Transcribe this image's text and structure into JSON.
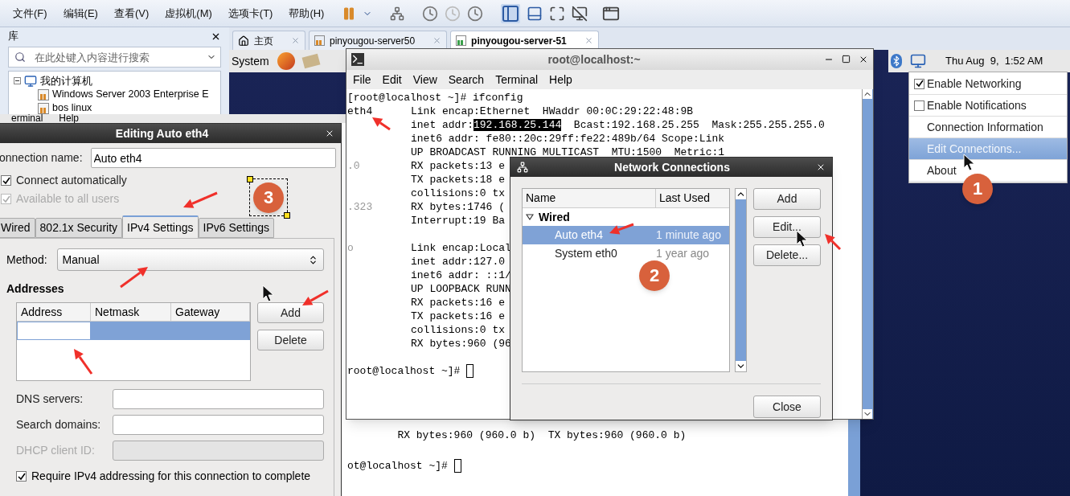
{
  "menu_bar": [
    "文件(F)",
    "编辑(E)",
    "查看(V)",
    "虚拟机(M)",
    "选项卡(T)",
    "帮助(H)"
  ],
  "library": {
    "title": "库",
    "search": {
      "placeholder": "在此处键入内容进行搜索"
    },
    "tree": [
      {
        "label": "我的计算机",
        "expanded": true,
        "children": [
          {
            "label": "Windows Server 2003 Enterprise E"
          },
          {
            "label": "bos linux"
          }
        ]
      }
    ]
  },
  "tabs": [
    {
      "label": "主页",
      "kind": "home",
      "selected": false
    },
    {
      "label": "pinyougou-server50",
      "kind": "vm",
      "selected": false
    },
    {
      "label": "pinyougou-server-51",
      "kind": "vm",
      "selected": true
    }
  ],
  "guest_panel": {
    "menu": "System",
    "clock": "Thu Aug  9,  1:52 AM"
  },
  "network_menu": [
    {
      "kind": "check",
      "label": "Enable Networking",
      "checked": true,
      "selected": false
    },
    {
      "kind": "check",
      "label": "Enable Notifications",
      "checked": false,
      "selected": false
    },
    {
      "kind": "item",
      "label": "Connection Information",
      "selected": false
    },
    {
      "kind": "item",
      "label": "Edit Connections...",
      "selected": true
    },
    {
      "kind": "item",
      "label": "About",
      "selected": false
    }
  ],
  "back_terminal": {
    "menu": [
      "erminal",
      "Help"
    ],
    "lines": [
      "        RX bytes:960 (960.0 b)  TX bytes:960 (960.0 b)",
      "ot@localhost ~]# "
    ]
  },
  "terminal": {
    "title": "root@localhost:~",
    "menu": [
      "File",
      "Edit",
      "View",
      "Search",
      "Terminal",
      "Help"
    ],
    "lines": [
      {
        "kind": "prompt",
        "text": "[root@localhost ~]# ifconfig",
        "cursor": false
      },
      {
        "kind": "row",
        "col1": "eth4",
        "faded": false,
        "text": "Link encap:Ethernet  HWaddr 00:0C:29:22:48:9B"
      },
      {
        "kind": "row",
        "text": "inet addr:",
        "selection": "192.168.25.144",
        "rest": "  Bcast:192.168.25.255  Mask:255.255.255.0"
      },
      {
        "kind": "row",
        "text": "inet6 addr: fe80::20c:29ff:fe22:489b/64 Scope:Link"
      },
      {
        "kind": "row",
        "text": "UP BROADCAST RUNNING MULTICAST  MTU:1500  Metric:1"
      },
      {
        "kind": "row",
        "col1": ".0",
        "faded": true,
        "text": "RX packets:13 e"
      },
      {
        "kind": "row",
        "text": "TX packets:18 e"
      },
      {
        "kind": "row",
        "text": "collisions:0 tx"
      },
      {
        "kind": "row",
        "col1": ".323",
        "faded": true,
        "text": "RX bytes:1746 ("
      },
      {
        "kind": "row",
        "text": "Interrupt:19 Ba"
      },
      {
        "kind": "blank"
      },
      {
        "kind": "row",
        "col1": "o",
        "faded": true,
        "text": "Link encap:Local"
      },
      {
        "kind": "row",
        "text": "inet addr:127.0"
      },
      {
        "kind": "row",
        "text": "inet6 addr: ::1/"
      },
      {
        "kind": "row",
        "text": "UP LOOPBACK RUNN"
      },
      {
        "kind": "row",
        "text": "RX packets:16 e"
      },
      {
        "kind": "row",
        "text": "TX packets:16 e"
      },
      {
        "kind": "row",
        "text": "collisions:0 tx"
      },
      {
        "kind": "row",
        "text": "RX bytes:960 (96"
      },
      {
        "kind": "blank"
      },
      {
        "kind": "prompt",
        "text": "root@localhost ~]# ",
        "cursor": true
      }
    ]
  },
  "network_dialog": {
    "title": "Network Connections",
    "columns": [
      "Name",
      "Last Used"
    ],
    "groups": [
      {
        "label": "Wired",
        "expanded": true,
        "children": [
          {
            "name": "Auto eth4",
            "last_used": "1 minute ago",
            "selected": true
          },
          {
            "name": "System eth0",
            "last_used": "1 year ago",
            "selected": false
          }
        ]
      }
    ],
    "buttons": [
      "Add",
      "Edit...",
      "Delete..."
    ],
    "close": "Close"
  },
  "edit_dialog": {
    "title": "Editing Auto eth4",
    "name_label": "onnection name:",
    "name_value": "Auto eth4",
    "checks": [
      {
        "label": "Connect automatically",
        "checked": true,
        "disabled": false
      },
      {
        "label": "Available to all users",
        "checked": true,
        "disabled": true
      }
    ],
    "tabs": [
      {
        "label": "Wired",
        "selected": false
      },
      {
        "label": "802.1x Security",
        "selected": false
      },
      {
        "label": "IPv4 Settings",
        "selected": true
      },
      {
        "label": "IPv6 Settings",
        "selected": false
      }
    ],
    "method_label": "Method:",
    "method_value": "Manual",
    "addresses_title": "Addresses",
    "columns": [
      "Address",
      "Netmask",
      "Gateway"
    ],
    "address_rows": [
      {
        "selected": true,
        "editing": true
      }
    ],
    "buttons": [
      "Add",
      "Delete"
    ],
    "fields": [
      {
        "label": "DNS servers:",
        "disabled": false
      },
      {
        "label": "Search domains:",
        "disabled": false
      },
      {
        "label": "DHCP client ID:",
        "disabled": true
      }
    ],
    "require": {
      "label": "Require IPv4 addressing for this connection to complete",
      "checked": true
    }
  },
  "badges": [
    {
      "label": "1",
      "selected": false
    },
    {
      "label": "2",
      "selected": false
    },
    {
      "label": "3",
      "selected": true
    }
  ]
}
